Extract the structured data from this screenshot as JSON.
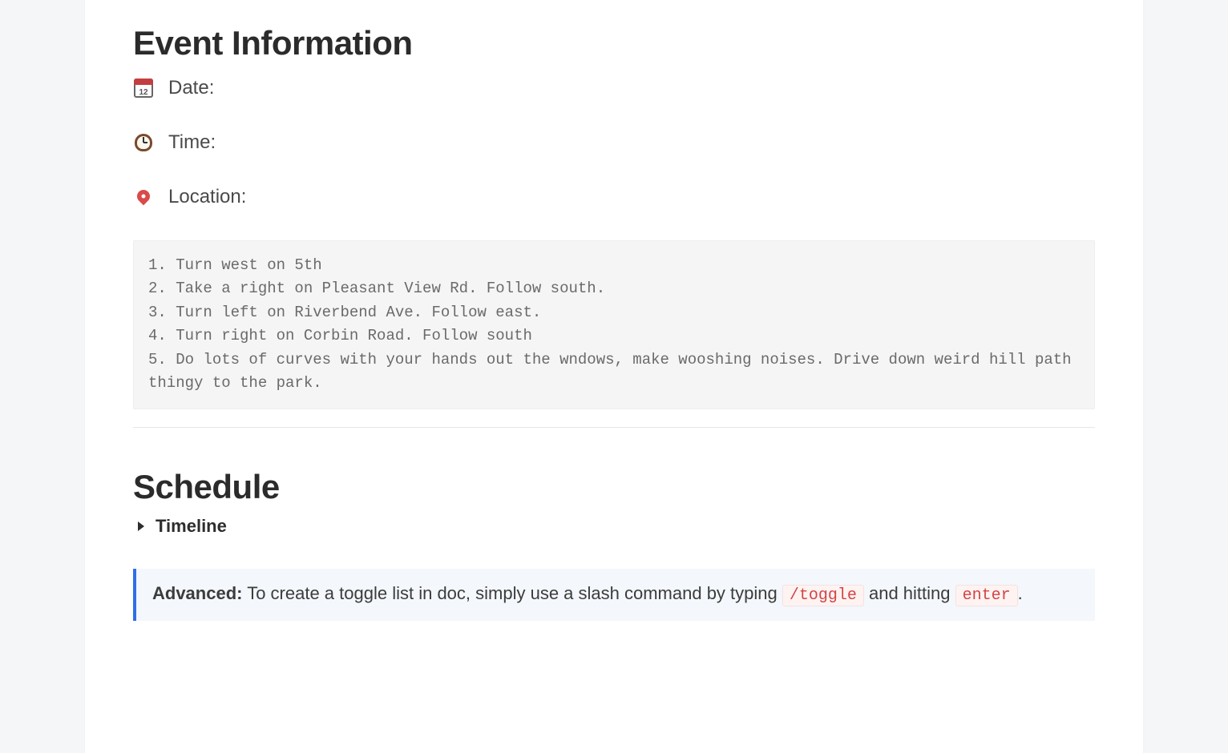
{
  "event_info": {
    "heading": "Event Information",
    "rows": [
      {
        "icon": "calendar-icon",
        "label": "Date:"
      },
      {
        "icon": "clock-icon",
        "label": "Time:"
      },
      {
        "icon": "pin-icon",
        "label": "Location:"
      }
    ],
    "directions_code": "1. Turn west on 5th\n2. Take a right on Pleasant View Rd. Follow south.\n3. Turn left on Riverbend Ave. Follow east.\n4. Turn right on Corbin Road. Follow south\n5. Do lots of curves with your hands out the wndows, make wooshing noises. Drive down weird hill path thingy to the park."
  },
  "schedule": {
    "heading": "Schedule",
    "toggle_label": "Timeline"
  },
  "callout": {
    "strong": "Advanced:",
    "text_before_code1": " To create a toggle list in doc, simply use a slash command by typing ",
    "code1": "/toggle",
    "text_between": " and hitting ",
    "code2": "enter",
    "text_after": "."
  }
}
